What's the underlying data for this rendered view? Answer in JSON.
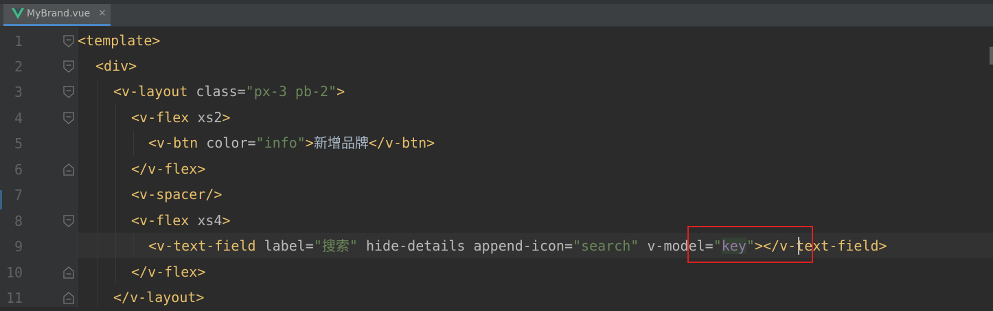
{
  "tab": {
    "icon": "vue-icon",
    "label": "MyBrand.vue",
    "close": "×",
    "accent_color": "#41b883"
  },
  "lines": [
    {
      "number": "1",
      "fold": "open"
    },
    {
      "number": "2",
      "fold": "open"
    },
    {
      "number": "3",
      "fold": "open"
    },
    {
      "number": "4",
      "fold": "open"
    },
    {
      "number": "5",
      "fold": "none"
    },
    {
      "number": "6",
      "fold": "close"
    },
    {
      "number": "7",
      "fold": "none"
    },
    {
      "number": "8",
      "fold": "open"
    },
    {
      "number": "9",
      "fold": "none"
    },
    {
      "number": "10",
      "fold": "close"
    },
    {
      "number": "11",
      "fold": "close"
    }
  ],
  "code": {
    "l1": {
      "tag": "<template>"
    },
    "l2": {
      "tag": "<div>"
    },
    "l3": {
      "open": "<v-layout",
      "attr": " class=",
      "val": "\"px-3 pb-2\"",
      "close": ">"
    },
    "l4": {
      "open": "<v-flex",
      "attr": " xs2",
      "close": ">"
    },
    "l5": {
      "open": "<v-btn",
      "attr": " color=",
      "val": "\"info\"",
      "close": ">",
      "text": "新增品牌",
      "end": "</v-btn>"
    },
    "l6": {
      "tag": "</v-flex>"
    },
    "l7": {
      "tag": "<v-spacer/>"
    },
    "l8": {
      "open": "<v-flex",
      "attr": " xs4",
      "close": ">"
    },
    "l9": {
      "open": "<v-text-field",
      "attr1": " label=",
      "val1_q1": "\"",
      "val1": "搜索",
      "val1_q2": "\"",
      "attr2": " hide-details append-icon=",
      "val2": "\"search\"",
      "attr3": " v-model=",
      "val3_q1": "\"",
      "val3": "key",
      "val3_q2": "\"",
      "close": ">",
      "end": "</v-text-field>"
    },
    "l10": {
      "tag": "</v-flex>"
    },
    "l11": {
      "tag": "</v-layout>"
    }
  },
  "colors": {
    "background": "#2b2b2b",
    "tag": "#e8bf6a",
    "string": "#6a8759",
    "attribute": "#bababa",
    "variable": "#9876aa",
    "annotation": "#e02020"
  }
}
